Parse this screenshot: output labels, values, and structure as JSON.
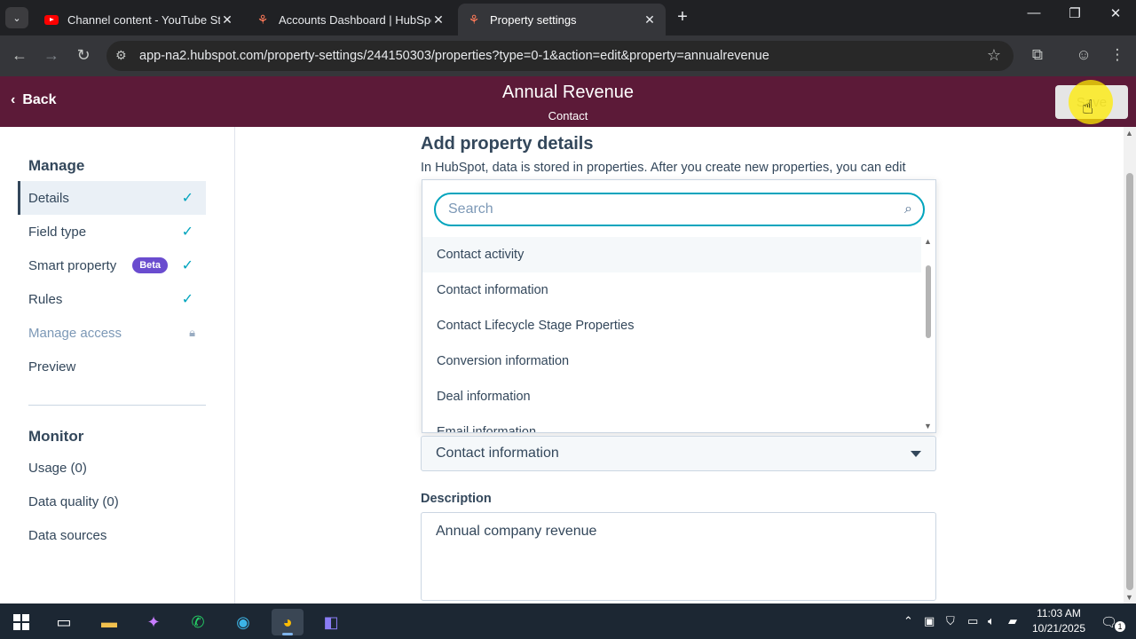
{
  "browser": {
    "tabs": [
      {
        "title": "Channel content - YouTube Stu",
        "favicon": "youtube-icon",
        "active": false
      },
      {
        "title": "Accounts Dashboard | HubSpot",
        "favicon": "hubspot-icon",
        "active": false
      },
      {
        "title": "Property settings",
        "favicon": "hubspot-icon",
        "active": true
      }
    ],
    "url": "app-na2.hubspot.com/property-settings/244150303/properties?type=0-1&action=edit&property=annualrevenue"
  },
  "header": {
    "back_label": "Back",
    "title": "Annual Revenue",
    "subtitle": "Contact",
    "save_label": "Save"
  },
  "sidebar": {
    "manage_heading": "Manage",
    "items": [
      {
        "label": "Details",
        "status": "check",
        "active": true
      },
      {
        "label": "Field type",
        "status": "check"
      },
      {
        "label": "Smart property",
        "badge": "Beta",
        "status": "check"
      },
      {
        "label": "Rules",
        "status": "check"
      },
      {
        "label": "Manage access",
        "status": "lock",
        "disabled": true
      },
      {
        "label": "Preview"
      }
    ],
    "monitor_heading": "Monitor",
    "monitor_items": [
      "Usage (0)",
      "Data quality (0)",
      "Data sources"
    ]
  },
  "main": {
    "title": "Add property details",
    "description": "In HubSpot, data is stored in properties. After you create new properties, you can edit",
    "search_placeholder": "Search",
    "options": [
      "Contact activity",
      "Contact information",
      "Contact Lifecycle Stage Properties",
      "Conversion information",
      "Deal information",
      "Email information"
    ],
    "group_selected": "Contact information",
    "description_label": "Description",
    "description_value": "Annual company revenue"
  },
  "taskbar": {
    "time": "11:03 AM",
    "date": "10/21/2025",
    "notification_count": "1"
  },
  "colors": {
    "header_bg": "#5c1a38",
    "focus_ring": "#00a4bd",
    "beta_badge": "#6a4ccf"
  }
}
